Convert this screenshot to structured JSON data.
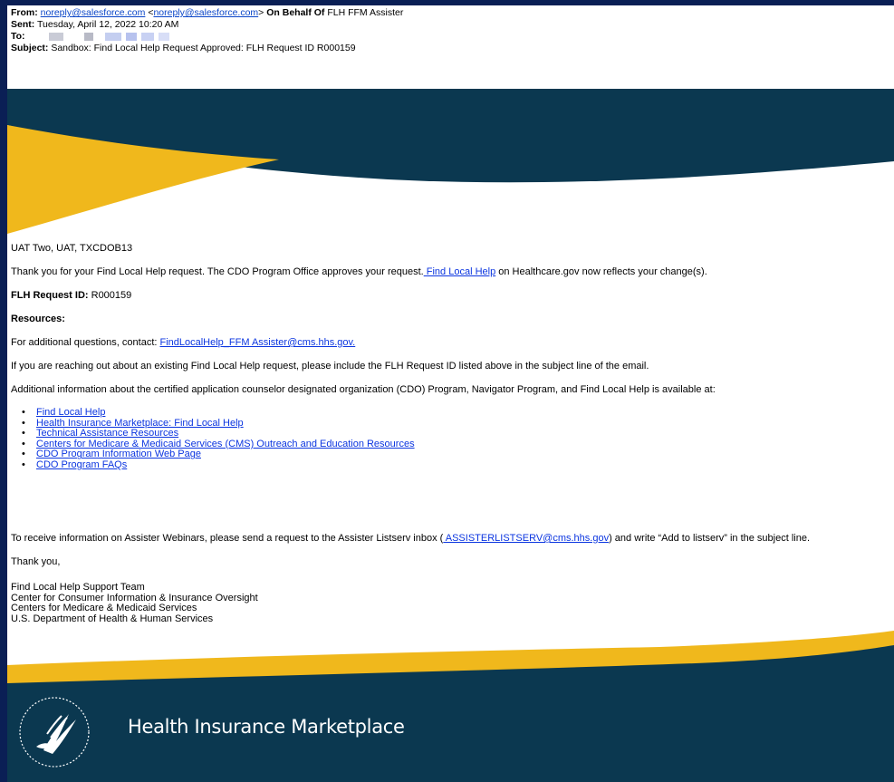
{
  "email": {
    "from_label": "From:",
    "from_address": "noreply@salesforce.com",
    "from_bracket_address": "noreply@salesforce.com",
    "on_behalf_label": "On Behalf Of",
    "on_behalf_name": "FLH FFM Assister",
    "sent_label": "Sent:",
    "sent_value": "Tuesday, April 12, 2022 10:20 AM",
    "to_label": "To:",
    "subject_label": "Subject:",
    "subject_value": "Sandbox: Find Local Help Request Approved: FLH Request ID R000159"
  },
  "message": {
    "greeting": "UAT Two, UAT, TXCDOB13",
    "intro_text": "Thank you for your Find Local Help request. The CDO Program Office approves your request.",
    "intro_link": " Find Local Help",
    "intro_suffix": " on Healthcare.gov now reflects your change(s).",
    "request_id_label": "FLH Request ID:",
    "request_id_value": " R000159",
    "resources_heading": "Resources:",
    "contact_text": "For additional questions, contact: ",
    "contact_link": "FindLocalHelp_FFM Assister@cms.hhs.gov.",
    "existing_request_text": "If you are reaching out about an existing Find Local Help request, please include the FLH Request ID listed above in the subject line of the email.",
    "additional_info_text": "Additional information about the certified application counselor designated organization (CDO) Program, Navigator Program, and Find Local Help is available at:",
    "links": [
      "Find Local Help",
      "Health Insurance Marketplace: Find Local Help",
      "Technical Assistance Resources",
      "Centers for Medicare & Medicaid Services (CMS) Outreach and Education Resources",
      "CDO Program Information Web Page",
      "CDO Program FAQs"
    ],
    "webinar_text": "To receive information on Assister Webinars, please send a request to the Assister Listserv inbox (",
    "webinar_link": " ASSISTERLISTSERV@cms.hhs.gov",
    "webinar_suffix": ") and write “Add to listserv” in the subject line.",
    "thank_you": "Thank you,",
    "signature": [
      "Find Local Help Support Team",
      "Center for Consumer Information & Insurance Oversight",
      "Centers for Medicare & Medicaid Services",
      "U.S. Department of Health & Human Services"
    ]
  },
  "footer": {
    "brand": "Health Insurance Marketplace",
    "seal_icon": "hhs-seal-icon"
  },
  "colors": {
    "navy": "#0b3850",
    "gold": "#f0b81c",
    "link": "#0b35e0",
    "frame": "#0a1f55"
  }
}
